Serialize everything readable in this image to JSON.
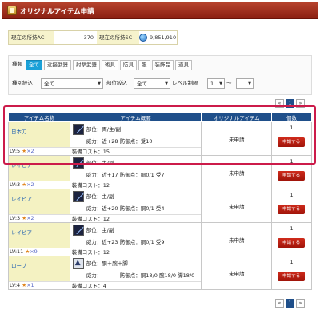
{
  "title": "オリジナルアイテム申請",
  "currency": {
    "ac_label": "現在の所持AC",
    "ac_value": "370",
    "sc_label": "現在の所持SC",
    "sc_value": "9,851,910"
  },
  "filters": {
    "kind_label": "種類",
    "tabs": [
      "全て",
      "近接武器",
      "射撃武器",
      "術具",
      "防具",
      "服",
      "装飾品",
      "道具"
    ],
    "active_tab": "全て",
    "kind_narrow_label": "種別絞込",
    "kind_narrow_value": "全て",
    "part_narrow_label": "部位絞込",
    "part_narrow_value": "全て",
    "level_label": "レベル制限",
    "level_from": "1",
    "level_sep": "～",
    "level_to": ""
  },
  "pager": {
    "prev": "«",
    "page": "1",
    "next": "»"
  },
  "table": {
    "headers": [
      "アイテム名称",
      "アイテム概要",
      "オリジナルアイテム",
      "個数"
    ],
    "apply_label": "申請する",
    "rows": [
      {
        "name": "日本刀",
        "lv": "LV:5",
        "rank": "×2",
        "part": "部位：両/主/副",
        "power": "威力：近+28",
        "defense": "防御点：受10",
        "cost": "装備コスト：15",
        "status": "未申請",
        "count": "1",
        "icon": "sword-icon"
      },
      {
        "name": "レイピア",
        "lv": "LV:3",
        "rank": "×2",
        "part": "部位：主/副",
        "power": "威力：近+17",
        "defense": "防御点：胴0/1 受7",
        "cost": "装備コスト：12",
        "status": "未申請",
        "count": "1",
        "icon": "rapier-icon"
      },
      {
        "name": "レイピア",
        "lv": "LV:3",
        "rank": "×2",
        "part": "部位：主/副",
        "power": "威力：近+20",
        "defense": "防御点：胴0/1 受4",
        "cost": "装備コスト：12",
        "status": "未申請",
        "count": "1",
        "icon": "rapier-icon"
      },
      {
        "name": "レイピア",
        "lv": "LV:11",
        "rank": "×9",
        "part": "部位：主/副",
        "power": "威力：近+23",
        "defense": "防御点：胴0/1 受9",
        "cost": "装備コスト：12",
        "status": "未申請",
        "count": "1",
        "icon": "rapier-icon"
      },
      {
        "name": "ローブ",
        "lv": "LV:4",
        "rank": "×1",
        "part": "部位：胴＋腕＋脚",
        "power": "威力：",
        "defense": "防御点：胴18/0 腕18/0 脚18/0",
        "cost": "装備コスト：4",
        "status": "未申請",
        "count": "1",
        "icon": "robe-icon"
      }
    ]
  }
}
